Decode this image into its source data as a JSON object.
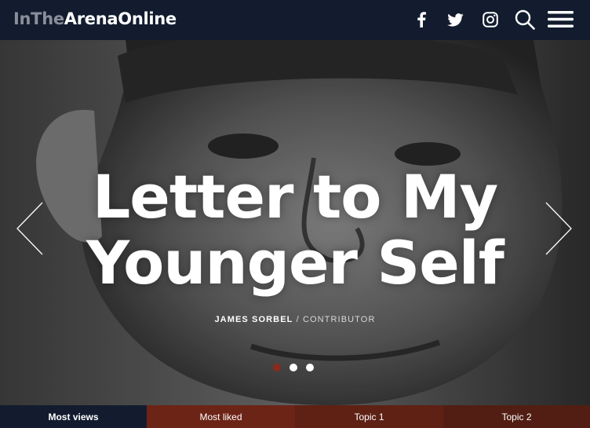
{
  "header": {
    "logo_part1": "InThe",
    "logo_part2": "ArenaOnline",
    "icons": [
      "facebook-icon",
      "twitter-icon",
      "instagram-icon",
      "search-icon",
      "menu-icon"
    ]
  },
  "hero": {
    "title_line1": "Letter to My",
    "title_line2": "Younger Self",
    "author": "JAMES SORBEL",
    "role_separator": " / ",
    "role": "CONTRIBUTOR",
    "slides_total": 3,
    "active_slide": 1
  },
  "tabs": [
    {
      "label": "Most views"
    },
    {
      "label": "Most liked"
    },
    {
      "label": "Topic 1"
    },
    {
      "label": "Topic 2"
    }
  ],
  "colors": {
    "header_bg": "#121c2e",
    "active_dot": "#8a2a1c",
    "tab_active": "#121c2e",
    "tab_inactive": "#6c2416"
  }
}
